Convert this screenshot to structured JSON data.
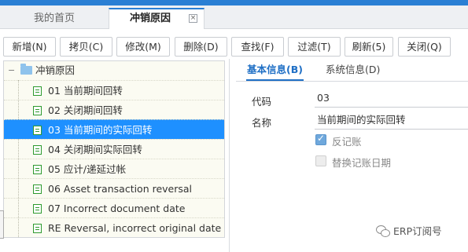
{
  "tabs": {
    "home": "我的首页",
    "active": "冲销原因",
    "close": "×"
  },
  "toolbar": {
    "new": "新增(N)",
    "copy": "拷贝(C)",
    "edit": "修改(M)",
    "delete": "删除(D)",
    "find": "查找(F)",
    "filter": "过滤(T)",
    "refresh": "刷新(5)",
    "close": "关闭(Q)"
  },
  "tree": {
    "root": "冲销原因",
    "items": [
      {
        "label": "01 当前期间回转"
      },
      {
        "label": "02 关闭期间回转"
      },
      {
        "label": "03 当前期间的实际回转",
        "selected": true
      },
      {
        "label": "04 关闭期间实际回转"
      },
      {
        "label": "05 应计/递延过帐"
      },
      {
        "label": "06 Asset transaction reversal"
      },
      {
        "label": "07 Incorrect document date"
      },
      {
        "label": "RE Reversal, incorrect original date"
      }
    ]
  },
  "detail": {
    "tabs": {
      "basic": "基本信息(B)",
      "system": "系统信息(D)"
    },
    "code_label": "代码",
    "code_value": "03",
    "name_label": "名称",
    "name_value": "当前期间的实际回转",
    "reverse_posting_label": "反记账",
    "reverse_posting_checked": true,
    "alt_posting_date_label": "替换记账日期",
    "alt_posting_date_checked": false
  },
  "watermark": "ERP订阅号",
  "colors": {
    "accent": "#2a7fd4",
    "selected_row": "#1e90ff",
    "tree_bg": "#fbfbf2",
    "doc_icon": "#2e9a2e"
  }
}
